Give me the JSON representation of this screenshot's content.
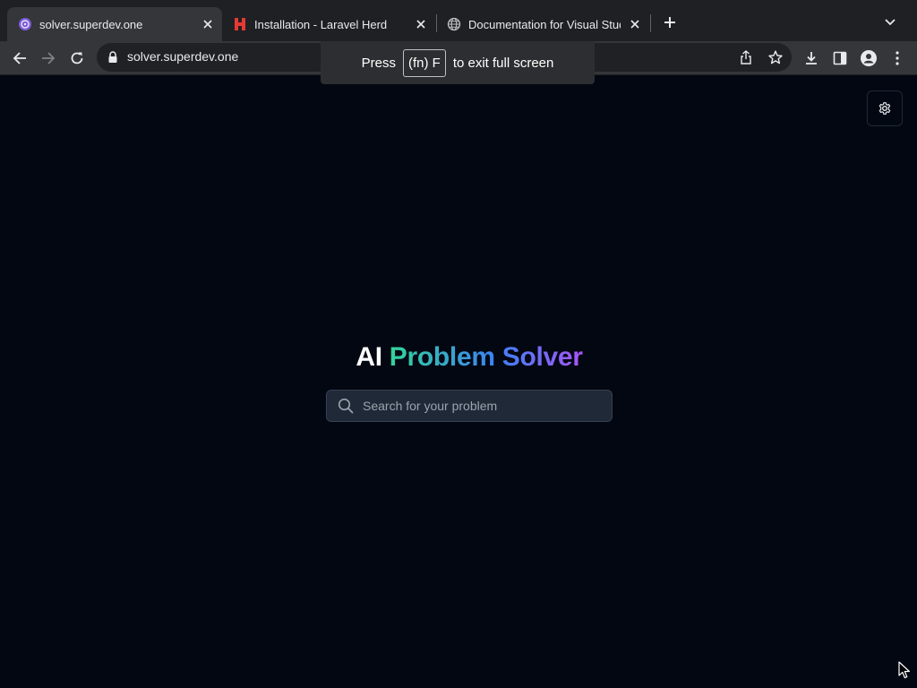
{
  "browser": {
    "tabs": [
      {
        "title": "solver.superdev.one",
        "active": true,
        "favicon": "solver-favicon"
      },
      {
        "title": "Installation - Laravel Herd",
        "active": false,
        "favicon": "herd-favicon"
      },
      {
        "title": "Documentation for Visual Studio Code",
        "active": false,
        "favicon": "globe-icon"
      }
    ],
    "address_bar": {
      "url": "solver.superdev.one"
    },
    "fullscreen_toast": {
      "prefix": "Press",
      "key": "(fn) F",
      "suffix": "to exit full screen"
    }
  },
  "page": {
    "title_plain": "AI",
    "title_gradient": "Problem Solver",
    "search": {
      "placeholder": "Search for your problem",
      "value": ""
    },
    "settings_icon": "gear-icon"
  },
  "colors": {
    "page_background": "#030712",
    "gradient_start": "#34d399",
    "gradient_mid": "#3b82f6",
    "gradient_end": "#a855f7",
    "herd_red": "#e53935"
  }
}
